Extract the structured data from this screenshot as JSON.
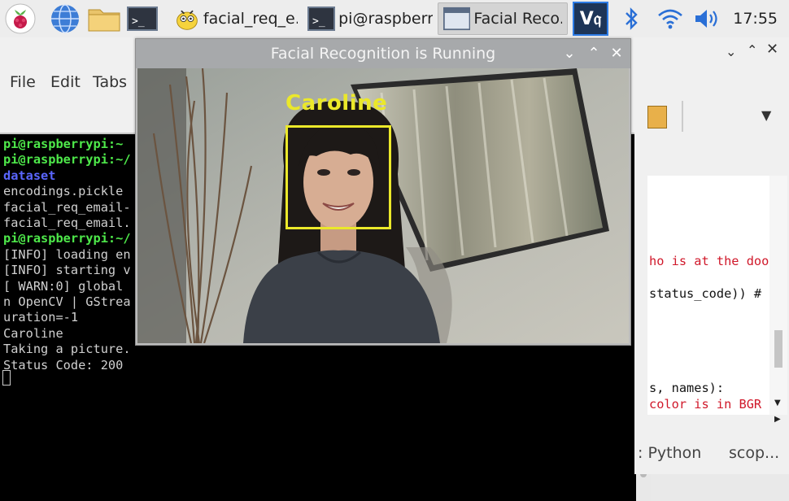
{
  "taskbar": {
    "apps": [
      {
        "label": "facial_req_e..."
      },
      {
        "label": "pi@raspberr..."
      },
      {
        "label": "Facial Reco..."
      }
    ],
    "clock": "17:55"
  },
  "terminal": {
    "menu": [
      "File",
      "Edit",
      "Tabs"
    ],
    "lines": [
      "pi@raspberrypi:~",
      "pi@raspberrypi:~/",
      "dataset",
      "encodings.pickle",
      "facial_req_email-",
      "facial_req_email.",
      "pi@raspberrypi:~/",
      "[INFO] loading en",
      "[INFO] starting v",
      "[ WARN:0] global",
      "n OpenCV | GStrea",
      "uration=-1",
      "Caroline",
      "Taking a picture.",
      "Status Code: 200"
    ]
  },
  "editor": {
    "lines": [
      "ho is at the doo",
      "status_code)) #",
      "s, names):",
      "color is in BGR"
    ],
    "status_language": ": Python",
    "status_scope": "scop..."
  },
  "facial_window": {
    "title": "Facial Recognition is Running",
    "detected_name": "Caroline"
  },
  "colors": {
    "face_box": "#ebe82a",
    "prompt_green": "#4ee84a",
    "dir_blue": "#5a66ff"
  }
}
